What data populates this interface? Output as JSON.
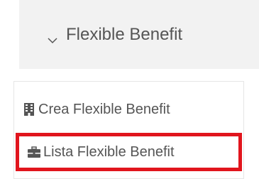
{
  "header": {
    "label": "Flexible Benefit",
    "icon": "chevron-down-icon"
  },
  "menu": {
    "items": [
      {
        "label": "Crea Flexible Benefit",
        "icon": "building-icon"
      },
      {
        "label": "Lista Flexible Benefit",
        "icon": "briefcase-icon",
        "highlighted": true
      }
    ]
  },
  "colors": {
    "header_bg": "#f2f2f2",
    "text": "#555555",
    "highlight_border": "#e1151d"
  }
}
